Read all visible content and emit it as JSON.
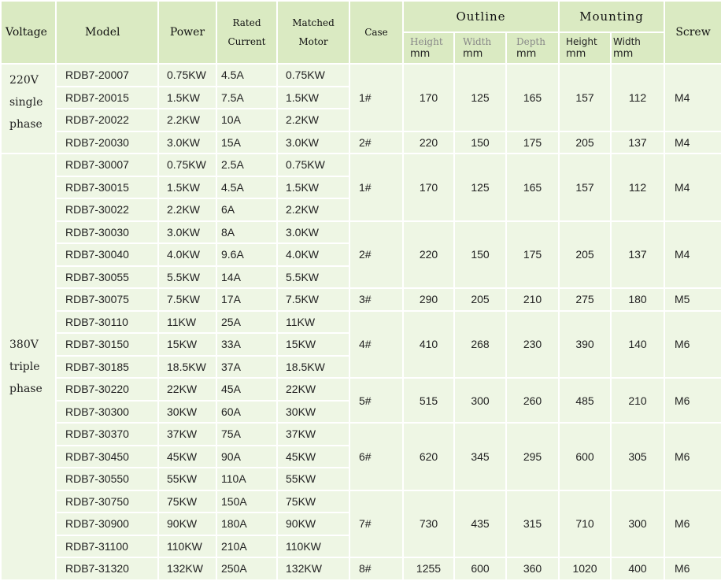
{
  "headers": {
    "voltage": "Voltage",
    "model": "Model",
    "power": "Power",
    "rated_current_line1": "Rated",
    "rated_current_line2": "Current",
    "matched_motor_line1": "Matched",
    "matched_motor_line2": "Motor",
    "case": "Case",
    "outline": "Outline",
    "mounting": "Mounting",
    "screw": "Screw",
    "outline_height": "Height",
    "outline_width": "Width",
    "outline_depth": "Depth",
    "mounting_height": "Height",
    "mounting_width": "Width",
    "unit": "mm"
  },
  "groups": [
    {
      "voltage_lines": [
        "220V",
        "single",
        "phase"
      ],
      "cases": [
        {
          "case": "1#",
          "outline_height": "170",
          "outline_width": "125",
          "outline_depth": "165",
          "mount_height": "157",
          "mount_width": "112",
          "screw": "M4",
          "rows": [
            {
              "model": "RDB7-20007",
              "power": "0.75KW",
              "current": "4.5A",
              "motor": "0.75KW"
            },
            {
              "model": "RDB7-20015",
              "power": "1.5KW",
              "current": "7.5A",
              "motor": "1.5KW"
            },
            {
              "model": "RDB7-20022",
              "power": "2.2KW",
              "current": "10A",
              "motor": "2.2KW"
            }
          ]
        },
        {
          "case": "2#",
          "outline_height": "220",
          "outline_width": "150",
          "outline_depth": "175",
          "mount_height": "205",
          "mount_width": "137",
          "screw": "M4",
          "rows": [
            {
              "model": "RDB7-20030",
              "power": "3.0KW",
              "current": "15A",
              "motor": "3.0KW"
            }
          ]
        }
      ]
    },
    {
      "voltage_lines": [
        "380V",
        "triple",
        "phase"
      ],
      "cases": [
        {
          "case": "1#",
          "outline_height": "170",
          "outline_width": "125",
          "outline_depth": "165",
          "mount_height": "157",
          "mount_width": "112",
          "screw": "M4",
          "rows": [
            {
              "model": "RDB7-30007",
              "power": "0.75KW",
              "current": "2.5A",
              "motor": "0.75KW"
            },
            {
              "model": "RDB7-30015",
              "power": "1.5KW",
              "current": "4.5A",
              "motor": "1.5KW"
            },
            {
              "model": "RDB7-30022",
              "power": "2.2KW",
              "current": "6A",
              "motor": "2.2KW"
            }
          ]
        },
        {
          "case": "2#",
          "outline_height": "220",
          "outline_width": "150",
          "outline_depth": "175",
          "mount_height": "205",
          "mount_width": "137",
          "screw": "M4",
          "rows": [
            {
              "model": "RDB7-30030",
              "power": "3.0KW",
              "current": "8A",
              "motor": "3.0KW"
            },
            {
              "model": "RDB7-30040",
              "power": "4.0KW",
              "current": "9.6A",
              "motor": "4.0KW"
            },
            {
              "model": "RDB7-30055",
              "power": "5.5KW",
              "current": "14A",
              "motor": "5.5KW"
            }
          ]
        },
        {
          "case": "3#",
          "outline_height": "290",
          "outline_width": "205",
          "outline_depth": "210",
          "mount_height": "275",
          "mount_width": "180",
          "screw": "M5",
          "rows": [
            {
              "model": "RDB7-30075",
              "power": "7.5KW",
              "current": "17A",
              "motor": "7.5KW"
            }
          ]
        },
        {
          "case": "4#",
          "outline_height": "410",
          "outline_width": "268",
          "outline_depth": "230",
          "mount_height": "390",
          "mount_width": "140",
          "screw": "M6",
          "rows": [
            {
              "model": "RDB7-30110",
              "power": "11KW",
              "current": "25A",
              "motor": "11KW"
            },
            {
              "model": "RDB7-30150",
              "power": "15KW",
              "current": "33A",
              "motor": "15KW"
            },
            {
              "model": "RDB7-30185",
              "power": "18.5KW",
              "current": "37A",
              "motor": "18.5KW"
            }
          ]
        },
        {
          "case": "5#",
          "outline_height": "515",
          "outline_width": "300",
          "outline_depth": "260",
          "mount_height": "485",
          "mount_width": "210",
          "screw": "M6",
          "rows": [
            {
              "model": "RDB7-30220",
              "power": "22KW",
              "current": "45A",
              "motor": "22KW"
            },
            {
              "model": "RDB7-30300",
              "power": "30KW",
              "current": "60A",
              "motor": "30KW"
            }
          ]
        },
        {
          "case": "6#",
          "outline_height": "620",
          "outline_width": "345",
          "outline_depth": "295",
          "mount_height": "600",
          "mount_width": "305",
          "screw": "M6",
          "rows": [
            {
              "model": "RDB7-30370",
              "power": "37KW",
              "current": "75A",
              "motor": "37KW"
            },
            {
              "model": "RDB7-30450",
              "power": "45KW",
              "current": "90A",
              "motor": "45KW"
            },
            {
              "model": "RDB7-30550",
              "power": "55KW",
              "current": "110A",
              "motor": "55KW"
            }
          ]
        },
        {
          "case": "7#",
          "outline_height": "730",
          "outline_width": "435",
          "outline_depth": "315",
          "mount_height": "710",
          "mount_width": "300",
          "screw": "M6",
          "rows": [
            {
              "model": "RDB7-30750",
              "power": "75KW",
              "current": "150A",
              "motor": "75KW"
            },
            {
              "model": "RDB7-30900",
              "power": "90KW",
              "current": "180A",
              "motor": "90KW"
            },
            {
              "model": "RDB7-31100",
              "power": "110KW",
              "current": "210A",
              "motor": "110KW"
            }
          ]
        },
        {
          "case": "8#",
          "outline_height": "1255",
          "outline_width": "600",
          "outline_depth": "360",
          "mount_height": "1020",
          "mount_width": "400",
          "screw": "M6",
          "rows": [
            {
              "model": "RDB7-31320",
              "power": "132KW",
              "current": "250A",
              "motor": "132KW"
            }
          ]
        }
      ]
    }
  ]
}
